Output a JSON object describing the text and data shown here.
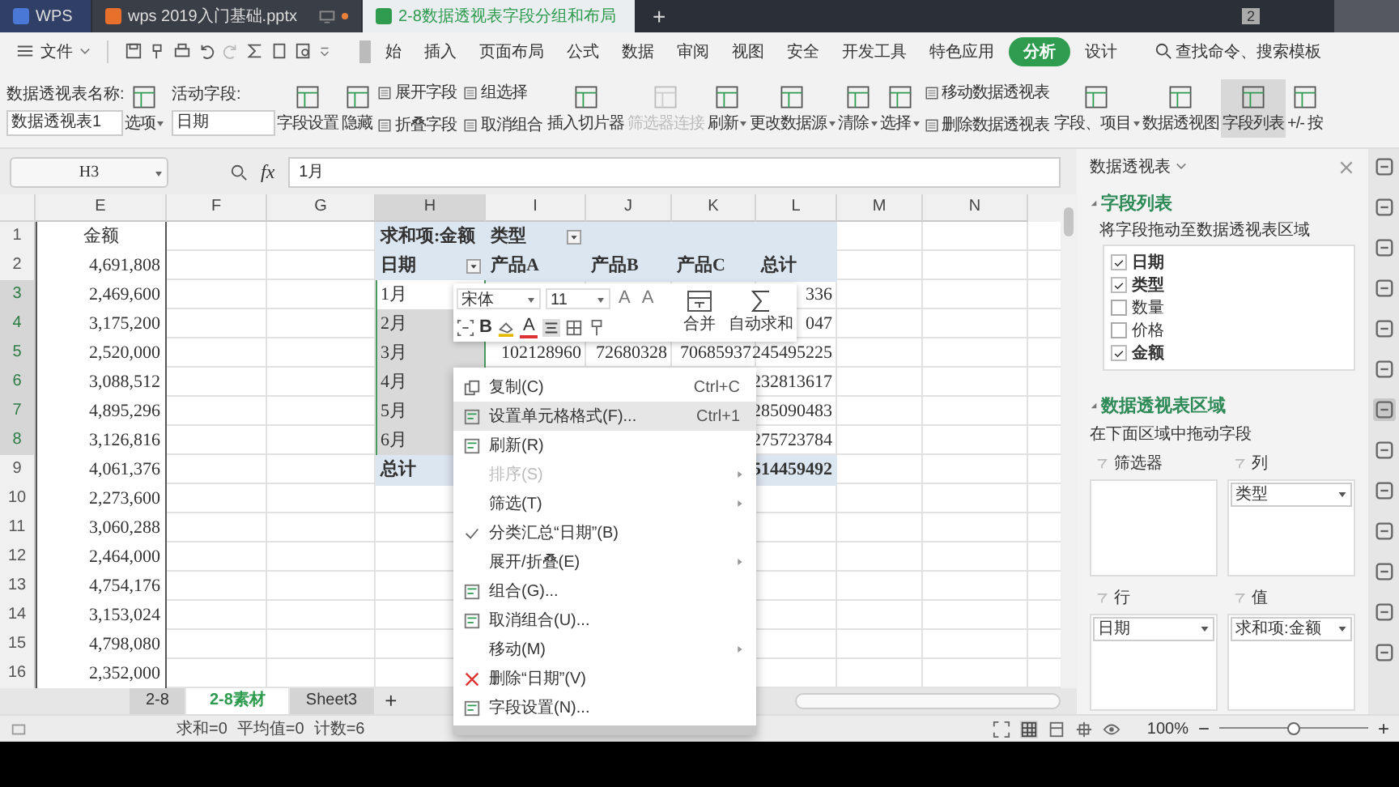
{
  "tabs": [
    {
      "label": "WPS",
      "kind": "home",
      "selected": false
    },
    {
      "label": "wps 2019入门基础.pptx",
      "kind": "presentation",
      "selected": false
    },
    {
      "label": "2-8数据透视表字段分组和布局",
      "kind": "sheet",
      "selected": true
    }
  ],
  "new_tab": "+",
  "badge": "2",
  "menu": {
    "file": "文件",
    "items": [
      {
        "label": "始",
        "selected": false
      },
      {
        "label": "插入",
        "selected": false
      },
      {
        "label": "页面布局",
        "selected": false
      },
      {
        "label": "公式",
        "selected": false
      },
      {
        "label": "数据",
        "selected": false
      },
      {
        "label": "审阅",
        "selected": false
      },
      {
        "label": "视图",
        "selected": false
      },
      {
        "label": "安全",
        "selected": false
      },
      {
        "label": "开发工具",
        "selected": false
      },
      {
        "label": "特色应用",
        "selected": false
      },
      {
        "label": "分析",
        "selected": true
      },
      {
        "label": "设计",
        "selected": false
      }
    ],
    "search": "查找命令、搜索模板"
  },
  "ribbon": {
    "name_label": "数据透视表名称:",
    "name_value": "数据透视表1",
    "options": "选项",
    "field_label": "活动字段:",
    "field_value": "日期",
    "tools": [
      {
        "kind": "large",
        "label": "字段设置",
        "dropdown": false,
        "disabled": false,
        "on": false
      },
      {
        "kind": "large",
        "label": "隐藏",
        "dropdown": false,
        "disabled": false,
        "on": false
      },
      {
        "kind": "pair",
        "labels": [
          "展开字段",
          "折叠字段"
        ]
      },
      {
        "kind": "pair",
        "labels": [
          "组选择",
          "取消组合"
        ]
      },
      {
        "kind": "large",
        "label": "插入切片器",
        "dropdown": false,
        "disabled": false,
        "on": false
      },
      {
        "kind": "large",
        "label": "筛选器连接",
        "dropdown": false,
        "disabled": true,
        "on": false
      },
      {
        "kind": "large",
        "label": "刷新",
        "dropdown": true,
        "disabled": false,
        "on": false
      },
      {
        "kind": "large",
        "label": "更改数据源",
        "dropdown": true,
        "disabled": false,
        "on": false
      },
      {
        "kind": "large",
        "label": "清除",
        "dropdown": true,
        "disabled": false,
        "on": false
      },
      {
        "kind": "large",
        "label": "选择",
        "dropdown": true,
        "disabled": false,
        "on": false
      },
      {
        "kind": "pair",
        "labels": [
          "移动数据透视表",
          "删除数据透视表"
        ]
      },
      {
        "kind": "large",
        "label": "字段、项目",
        "dropdown": true,
        "disabled": false,
        "on": false
      },
      {
        "kind": "large",
        "label": "数据透视图",
        "dropdown": false,
        "disabled": false,
        "on": false
      },
      {
        "kind": "large",
        "label": "字段列表",
        "dropdown": false,
        "disabled": false,
        "on": true
      },
      {
        "kind": "large",
        "label": "+/- 按",
        "dropdown": false,
        "disabled": false,
        "on": false
      }
    ]
  },
  "sheet": {
    "name_box": "H3",
    "fx": "fx",
    "formula": "1月",
    "columns": [
      {
        "label": "E",
        "selected": false
      },
      {
        "label": "F",
        "selected": false
      },
      {
        "label": "G",
        "selected": false
      },
      {
        "label": "H",
        "selected": true
      },
      {
        "label": "I",
        "selected": false
      },
      {
        "label": "J",
        "selected": false
      },
      {
        "label": "K",
        "selected": false
      },
      {
        "label": "L",
        "selected": false
      },
      {
        "label": "M",
        "selected": false
      },
      {
        "label": "N",
        "selected": false
      }
    ],
    "row_numbers": [
      {
        "num": "1",
        "selected": false
      },
      {
        "num": "2",
        "selected": false
      },
      {
        "num": "3",
        "selected": true
      },
      {
        "num": "4",
        "selected": true
      },
      {
        "num": "5",
        "selected": true
      },
      {
        "num": "6",
        "selected": true
      },
      {
        "num": "7",
        "selected": true
      },
      {
        "num": "8",
        "selected": true
      },
      {
        "num": "9",
        "selected": false
      },
      {
        "num": "10",
        "selected": false
      },
      {
        "num": "11",
        "selected": false
      },
      {
        "num": "12",
        "selected": false
      },
      {
        "num": "13",
        "selected": false
      },
      {
        "num": "14",
        "selected": false
      },
      {
        "num": "15",
        "selected": false
      },
      {
        "num": "16",
        "selected": false
      }
    ],
    "amounts": [
      "金额",
      "4,691,808",
      "2,469,600",
      "3,175,200",
      "2,520,000",
      "3,088,512",
      "4,895,296",
      "3,126,816",
      "4,061,376",
      "2,273,600",
      "3,060,288",
      "2,464,000",
      "4,754,176",
      "3,153,024",
      "4,798,080",
      "2,352,000"
    ],
    "pivot": {
      "corner": "求和项:金额",
      "col_field": "类型",
      "row_field": "日期",
      "col_headers": [
        "产品A",
        "产品B",
        "产品C",
        "总计"
      ],
      "rows": [
        {
          "label": "1月",
          "selected": true,
          "active": true,
          "values": [
            "336"
          ]
        },
        {
          "label": "2月",
          "selected": true,
          "active": false,
          "values": [
            "047"
          ]
        },
        {
          "label": "3月",
          "selected": true,
          "active": false,
          "values": [
            "102128960",
            "72680328",
            "70685937",
            "245495225"
          ]
        },
        {
          "label": "4月",
          "selected": true,
          "active": false,
          "values": [
            "232813617"
          ]
        },
        {
          "label": "5月",
          "selected": true,
          "active": false,
          "values": [
            "285090483"
          ]
        },
        {
          "label": "6月",
          "selected": true,
          "active": false,
          "values": [
            "275723784"
          ]
        }
      ],
      "total": {
        "label": "总计",
        "values": [
          "514459492"
        ]
      }
    },
    "sheet_tabs": [
      {
        "label": "2-8",
        "selected": false
      },
      {
        "label": "2-8素材",
        "selected": true
      },
      {
        "label": "Sheet3",
        "selected": false
      }
    ],
    "add_sheet": "+"
  },
  "mini_toolbar": {
    "font": "宋体",
    "size": "11",
    "grow": "A",
    "shrink": "A",
    "bold": "B",
    "font_color_letter": "A",
    "merge": "合并",
    "autosum": "自动求和"
  },
  "context_menu": [
    {
      "label": "复制(C)",
      "shortcut": "Ctrl+C",
      "kind": "copy",
      "selected": false,
      "disabled": false,
      "checked": false,
      "submenu": false
    },
    {
      "label": "设置单元格格式(F)...",
      "shortcut": "Ctrl+1",
      "kind": "doc",
      "selected": true,
      "disabled": false,
      "checked": false,
      "submenu": false
    },
    {
      "label": "刷新(R)",
      "kind": "doc",
      "selected": false,
      "disabled": false,
      "checked": false,
      "submenu": false
    },
    {
      "label": "排序(S)",
      "kind": "none",
      "selected": false,
      "disabled": true,
      "checked": false,
      "submenu": true
    },
    {
      "label": "筛选(T)",
      "kind": "none",
      "selected": false,
      "disabled": false,
      "checked": false,
      "submenu": true
    },
    {
      "label": "分类汇总“日期”(B)",
      "kind": "none",
      "selected": false,
      "disabled": false,
      "checked": true,
      "submenu": false
    },
    {
      "label": "展开/折叠(E)",
      "kind": "none",
      "selected": false,
      "disabled": false,
      "checked": false,
      "submenu": true
    },
    {
      "label": "组合(G)...",
      "kind": "doc",
      "selected": false,
      "disabled": false,
      "checked": false,
      "submenu": false
    },
    {
      "label": "取消组合(U)...",
      "kind": "doc",
      "selected": false,
      "disabled": false,
      "checked": false,
      "submenu": false
    },
    {
      "label": "移动(M)",
      "kind": "none",
      "selected": false,
      "disabled": false,
      "checked": false,
      "submenu": true
    },
    {
      "label": "删除“日期”(V)",
      "kind": "delete",
      "selected": false,
      "disabled": false,
      "checked": false,
      "submenu": false
    },
    {
      "label": "字段设置(N)...",
      "kind": "doc",
      "selected": false,
      "disabled": false,
      "checked": false,
      "submenu": false
    }
  ],
  "panel": {
    "title": "数据透视表",
    "field_section": "字段列表",
    "field_hint": "将字段拖动至数据透视表区域",
    "fields": [
      {
        "label": "日期",
        "checked": true
      },
      {
        "label": "类型",
        "checked": true
      },
      {
        "label": "数量",
        "checked": false
      },
      {
        "label": "价格",
        "checked": false
      },
      {
        "label": "金额",
        "checked": true
      }
    ],
    "area_section": "数据透视表区域",
    "area_hint": "在下面区域中拖动字段",
    "areas": [
      {
        "label": "筛选器"
      },
      {
        "label": "列",
        "items": [
          "类型"
        ]
      },
      {
        "label": "行",
        "items": [
          "日期"
        ]
      },
      {
        "label": "值",
        "items": [
          "求和项:金额"
        ]
      }
    ]
  },
  "side_tools": [
    {
      "selected": false
    },
    {
      "selected": false
    },
    {
      "selected": false
    },
    {
      "selected": false
    },
    {
      "selected": false
    },
    {
      "selected": false
    },
    {
      "selected": true
    },
    {
      "selected": false
    },
    {
      "selected": false
    },
    {
      "selected": false
    },
    {
      "selected": false
    },
    {
      "selected": false
    },
    {
      "selected": false
    }
  ],
  "status": {
    "stats": [
      "求和=0",
      "平均值=0",
      "计数=6"
    ],
    "zoom": "100%",
    "minus": "−",
    "plus": "+",
    "level": 0.5
  }
}
